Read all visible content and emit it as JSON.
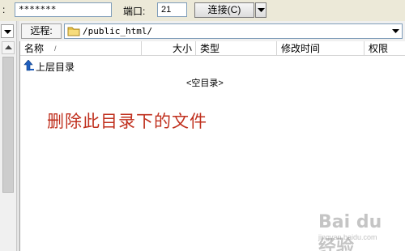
{
  "toolbar": {
    "leading_colon": ":",
    "password_value": "*******",
    "port_label": "端口:",
    "port_value": "21",
    "connect_label": "连接(C)"
  },
  "remote": {
    "label": "远程:",
    "path": "/public_html/"
  },
  "columns": {
    "name": "名称",
    "sort_indicator": "/",
    "size": "大小",
    "type": "类型",
    "mtime": "修改时间",
    "perm": "权限"
  },
  "list": {
    "up_dir": "上层目录",
    "empty": "<空目录>"
  },
  "annotation": "删除此目录下的文件",
  "watermark": {
    "text": "Bai du 经验",
    "sub": "jingyan.baidu.com"
  },
  "colors": {
    "annotation": "#c0301e",
    "folder": "#e8c34a",
    "up_arrow": "#1f5fbf"
  },
  "icons": [
    "folder-icon",
    "up-arrow-icon",
    "dropdown-arrow-icon",
    "scroll-up-arrow-icon"
  ]
}
